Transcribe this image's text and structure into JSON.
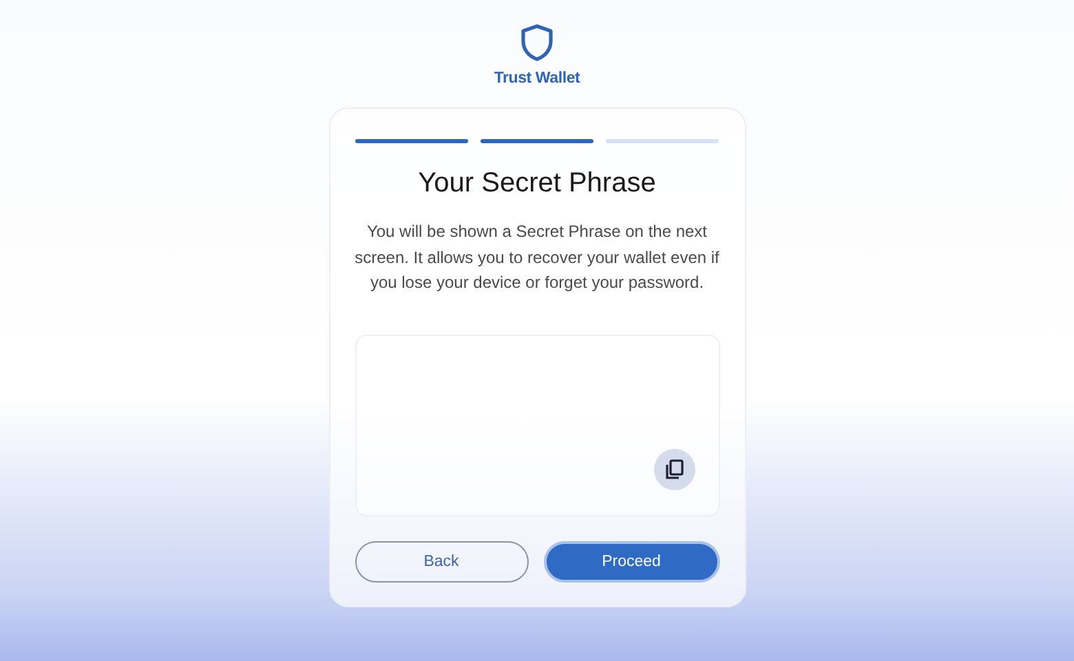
{
  "brand": {
    "name": "Trust Wallet"
  },
  "steps": [
    {
      "done": true
    },
    {
      "done": true
    },
    {
      "done": false
    }
  ],
  "title": "Your Secret Phrase",
  "description": "You will be shown a Secret Phrase on the next screen. It allows you to recover your wallet even if you lose your device or forget your password.",
  "phrase_box": {
    "kind": "empty"
  },
  "buttons": [
    {
      "label": "Back",
      "kind": "secondary"
    },
    {
      "label": "Proceed",
      "kind": "primary"
    }
  ]
}
